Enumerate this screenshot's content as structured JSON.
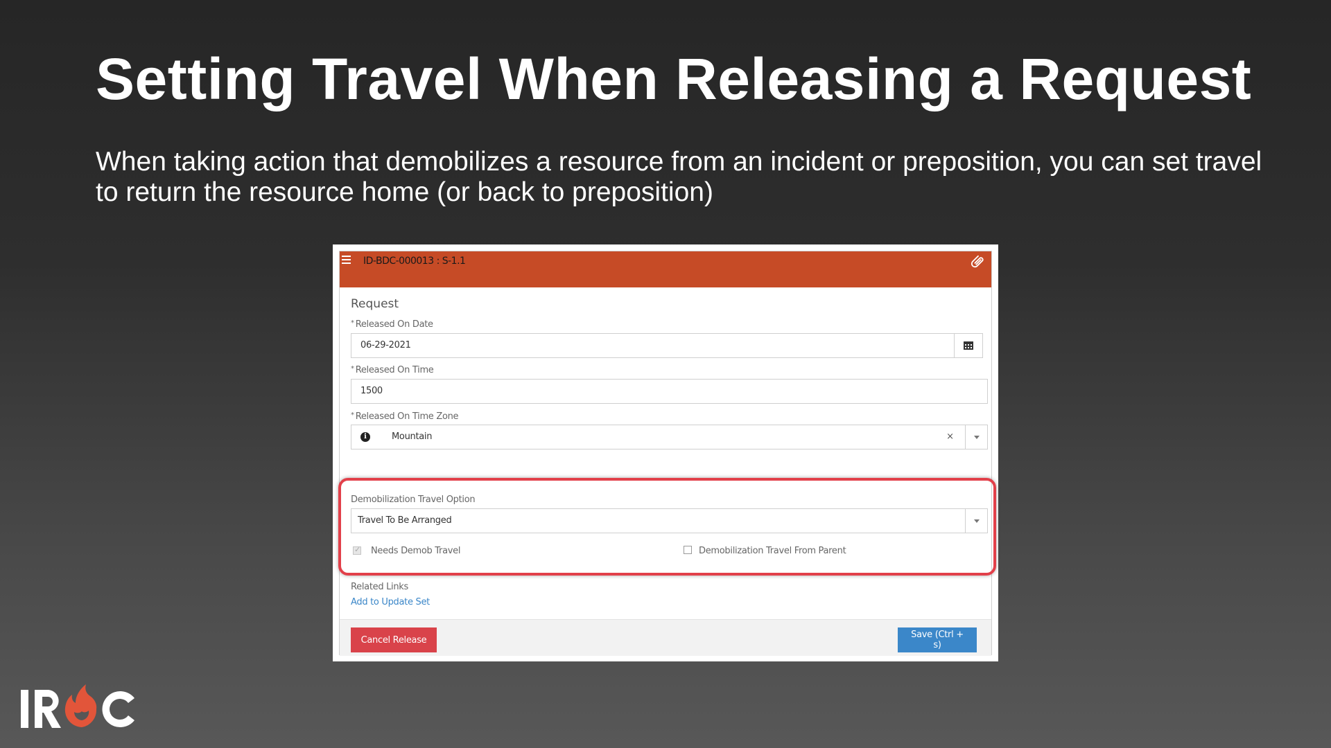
{
  "slide": {
    "title": "Setting Travel When Releasing a Request",
    "subtitle": "When taking action that demobilizes a resource from an incident or preposition, you can set travel to return the resource home (or back to preposition)"
  },
  "app": {
    "record_id": "ID-BDC-000013 : S-1.1",
    "header_color": "#c64b26",
    "section_title": "Request",
    "fields": {
      "released_on_date": {
        "label": "Released On Date",
        "value": "06-29-2021",
        "required": true
      },
      "released_on_time": {
        "label": "Released On Time",
        "value": "1500",
        "required": true
      },
      "released_on_time_zone": {
        "label": "Released On Time Zone",
        "value": "Mountain",
        "clear": "×",
        "required": true
      },
      "demob_travel_option": {
        "label": "Demobilization Travel Option",
        "value": "Travel To Be Arranged"
      }
    },
    "checkboxes": {
      "needs_demob_travel": {
        "label": "Needs Demob Travel",
        "checked": true,
        "disabled": true
      },
      "demob_travel_from_parent": {
        "label": "Demobilization Travel From Parent",
        "checked": false
      }
    },
    "related_links": {
      "title": "Related Links",
      "add_to_update_set": "Add to Update Set"
    },
    "buttons": {
      "cancel_release": "Cancel Release",
      "save": "Save (Ctrl + s)"
    },
    "colors": {
      "highlight": "#e2404a",
      "cancel": "#d9434a",
      "save": "#3b87c9",
      "link": "#3a86c8"
    }
  },
  "logo": {
    "text": "IROC",
    "flame_color": "#e2553a"
  },
  "icons": {
    "menu": "hamburger-icon",
    "attachment": "paperclip-icon",
    "calendar": "calendar-icon",
    "info": "info-icon",
    "dropdown": "chevron-down-icon"
  }
}
